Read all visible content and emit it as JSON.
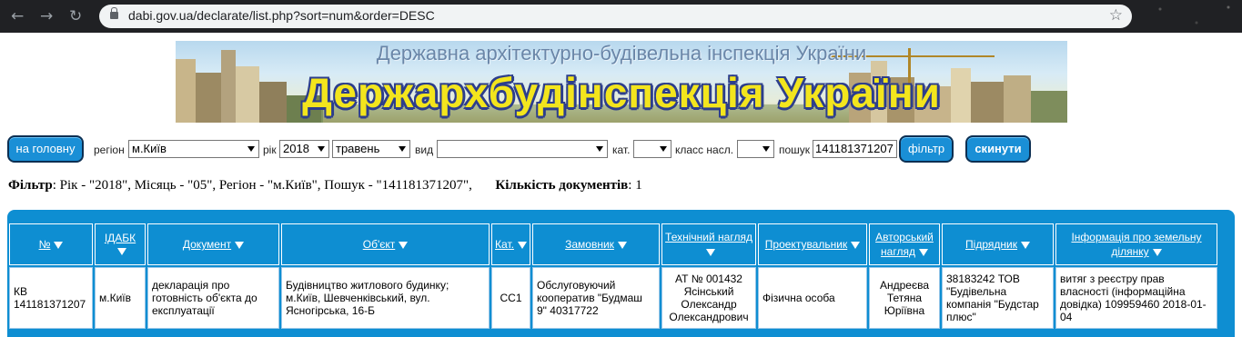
{
  "browser": {
    "url": "dabi.gov.ua/declarate/list.php?sort=num&order=DESC",
    "back_icon": "arrow-left-icon",
    "forward_icon": "arrow-right-icon",
    "reload_icon": "reload-icon",
    "star_icon": "star-icon"
  },
  "banner": {
    "subtitle": "Державна архітектурно-будівельна інспекція України",
    "title": "Держархбудінспекція України"
  },
  "filters": {
    "home_button": "на головну",
    "region_label": "регіон",
    "region_value": "м.Київ",
    "year_label": "рік",
    "year_value": "2018",
    "month_value": "травень",
    "type_label": "вид",
    "type_value": "",
    "cat_label": "кат.",
    "cat_value": "",
    "class_label": "класс насл.",
    "class_value": "",
    "search_label": "пошук",
    "search_value": "141181371207",
    "filter_button": "фільтр",
    "reset_button": "скинути"
  },
  "summary": {
    "filter_label": "Фільтр",
    "filter_text": ": Рік - \"2018\", Місяць - \"05\", Регіон - \"м.Київ\", Пошук - \"141181371207\",",
    "count_label": "Кількість документів",
    "count_text": ": 1"
  },
  "table": {
    "headers": [
      "№",
      "ІДАБК",
      "Документ",
      "Об'єкт",
      "Кат.",
      "Замовник",
      "Технічний нагляд",
      "Проектувальник",
      "Авторський нагляд",
      "Підрядник",
      "Інформація про земельну ділянку"
    ],
    "row": {
      "num": "КВ 141181371207",
      "idabk": "м.Київ",
      "document": "декларація про готовність об'єкта до експлуатації",
      "object": "Будівництво житлового будинку; м.Київ, Шевченківський, вул. Ясногірська, 16-Б",
      "cat": "СС1",
      "customer": "Обслуговуючий кооператив \"Будмаш 9\" 40317722",
      "tech": "АТ № 001432 Ясінський Олександр Олександрович",
      "designer": "Фізична особа",
      "author": "Андреєва Тетяна Юріївна",
      "contractor": "38183242 ТОВ \"Будівельна компанія \"Будстар плюс\"",
      "land": "витяг з реєстру прав власності (інформаційна довідка) 109959460 2018-01-04"
    }
  }
}
